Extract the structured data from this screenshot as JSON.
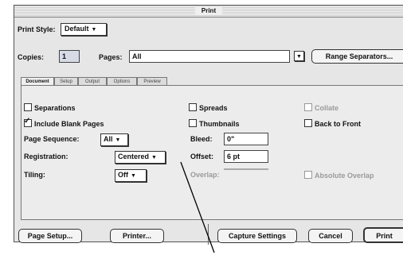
{
  "window": {
    "title": "Print"
  },
  "print_style": {
    "label": "Print Style:",
    "value": "Default"
  },
  "copies": {
    "label": "Copies:",
    "value": "1"
  },
  "pages": {
    "label": "Pages:",
    "value": "All"
  },
  "range_separators_button": "Range Separators...",
  "tabs": [
    "Document",
    "Setup",
    "Output",
    "Options",
    "Preview"
  ],
  "document": {
    "separations": "Separations",
    "include_blank_pages": "Include Blank Pages",
    "page_sequence": {
      "label": "Page Sequence:",
      "value": "All"
    },
    "registration": {
      "label": "Registration:",
      "value": "Centered"
    },
    "tiling": {
      "label": "Tiling:",
      "value": "Off"
    },
    "spreads": "Spreads",
    "thumbnails": "Thumbnails",
    "bleed": {
      "label": "Bleed:",
      "value": "0\""
    },
    "offset": {
      "label": "Offset:",
      "value": "6 pt"
    },
    "overlap": {
      "label": "Overlap:",
      "value": ""
    },
    "collate": "Collate",
    "back_to_front": "Back to Front",
    "absolute_overlap": "Absolute Overlap"
  },
  "buttons": {
    "page_setup": "Page Setup...",
    "printer": "Printer...",
    "capture_settings": "Capture Settings",
    "cancel": "Cancel",
    "print": "Print"
  },
  "state": {
    "include_blank_pages_checked": true,
    "dimmed": [
      "collate",
      "overlap",
      "absolute_overlap"
    ]
  }
}
